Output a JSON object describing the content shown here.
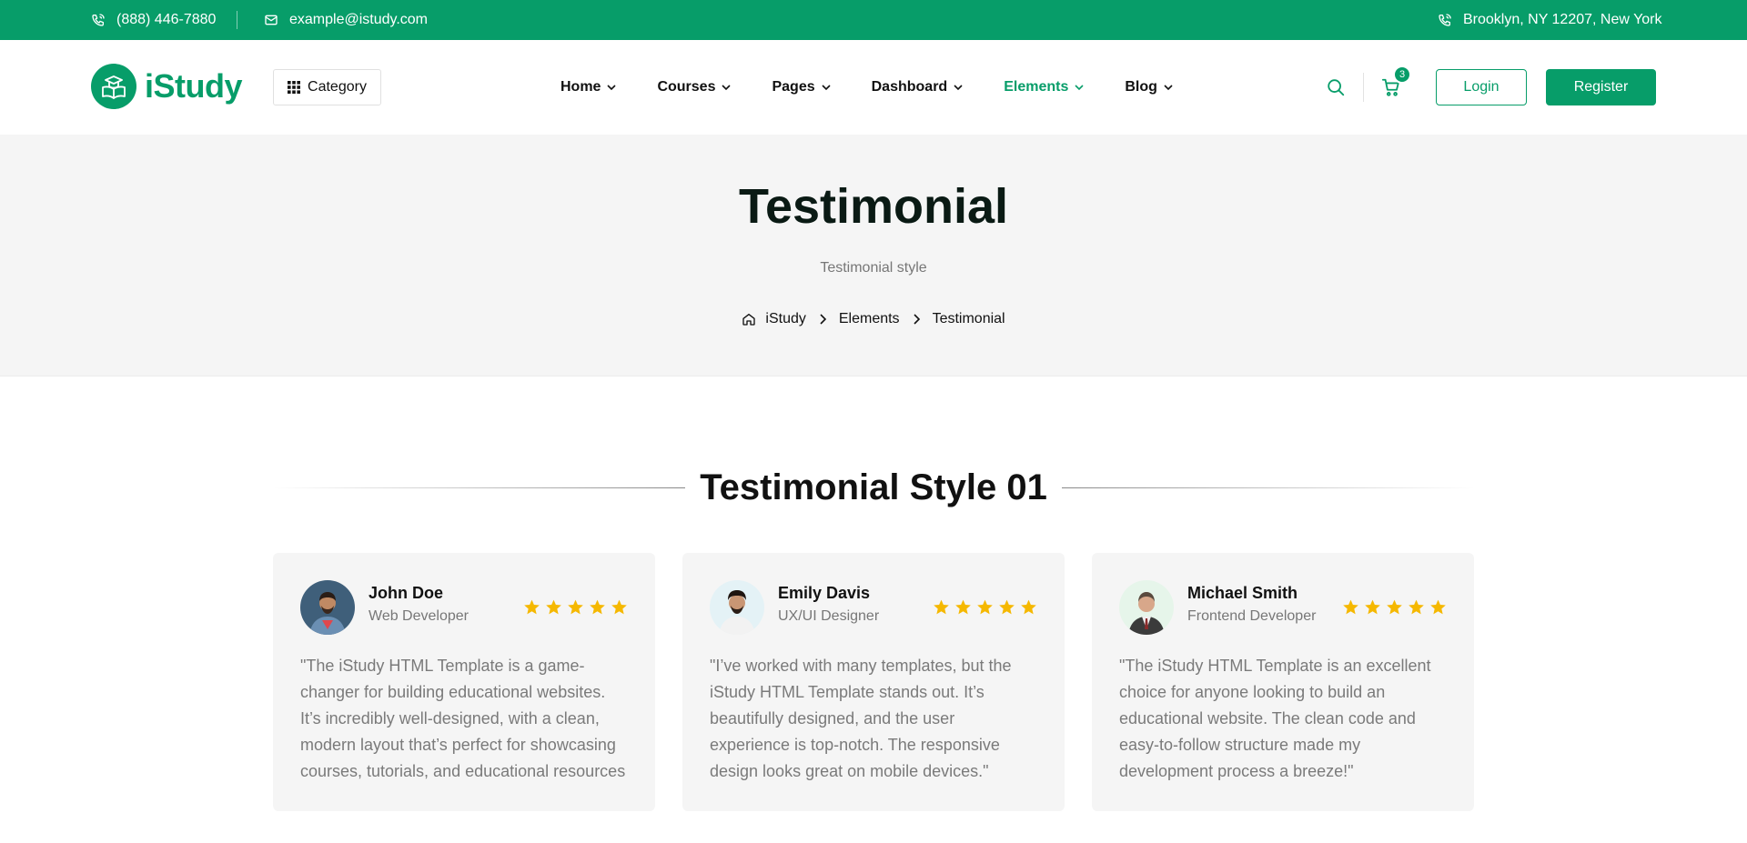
{
  "topbar": {
    "phone": "(888) 446-7880",
    "email": "example@istudy.com",
    "address": "Brooklyn, NY 12207, New York"
  },
  "header": {
    "logo": "iStudy",
    "category_label": "Category",
    "nav": [
      {
        "label": "Home",
        "active": false
      },
      {
        "label": "Courses",
        "active": false
      },
      {
        "label": "Pages",
        "active": false
      },
      {
        "label": "Dashboard",
        "active": false
      },
      {
        "label": "Elements",
        "active": true
      },
      {
        "label": "Blog",
        "active": false
      }
    ],
    "cart_count": "3",
    "login_label": "Login",
    "register_label": "Register"
  },
  "hero": {
    "title": "Testimonial",
    "subtitle": "Testimonial style",
    "breadcrumb": [
      "iStudy",
      "Elements",
      "Testimonial"
    ]
  },
  "section": {
    "title": "Testimonial Style 01"
  },
  "testimonials": [
    {
      "name": "John Doe",
      "role": "Web Developer",
      "rating": 5,
      "quote": "\"The iStudy HTML Template is a game-changer for building educational websites. It’s incredibly well-designed, with a clean, modern layout that’s perfect for showcasing courses, tutorials, and educational resources"
    },
    {
      "name": "Emily Davis",
      "role": "UX/UI Designer",
      "rating": 5,
      "quote": "\"I’ve worked with many templates, but the iStudy HTML Template stands out. It’s beautifully designed, and the user experience is top-notch. The responsive design looks great on mobile devices.\""
    },
    {
      "name": "Michael Smith",
      "role": "Frontend Developer",
      "rating": 5,
      "quote": "\"The iStudy HTML Template is an excellent choice for anyone looking to build an educational website. The clean code and easy-to-follow structure made my development process a breeze!\""
    }
  ],
  "colors": {
    "brand": "#079d69",
    "star": "#f5b800"
  }
}
